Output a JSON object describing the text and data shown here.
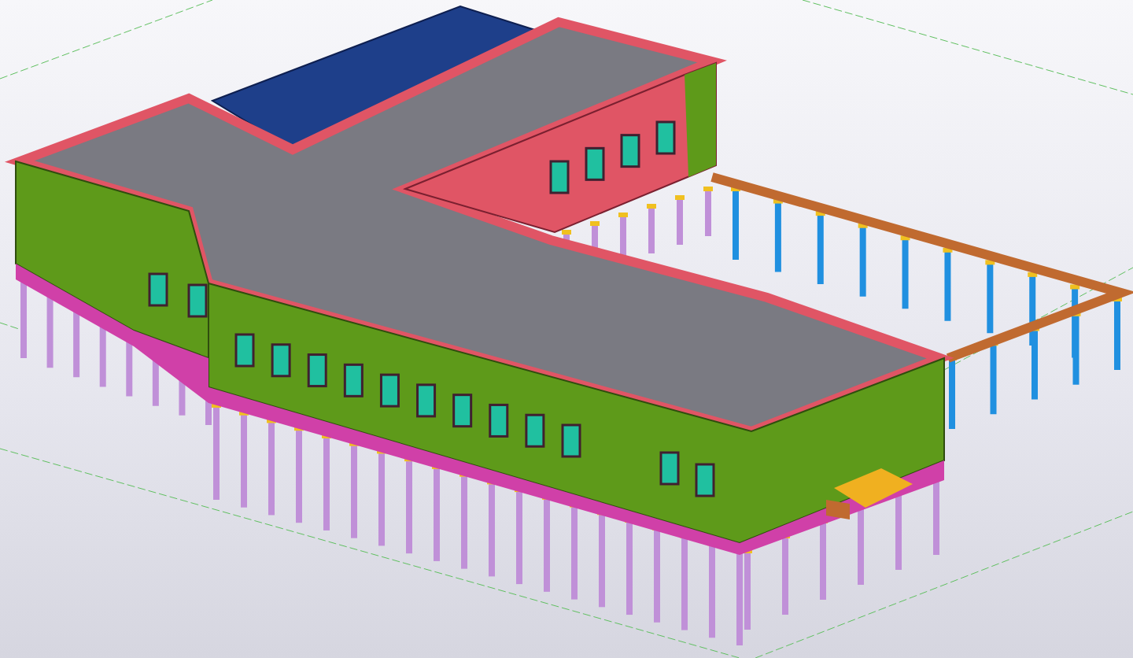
{
  "viewport": {
    "kind": "model-view"
  }
}
